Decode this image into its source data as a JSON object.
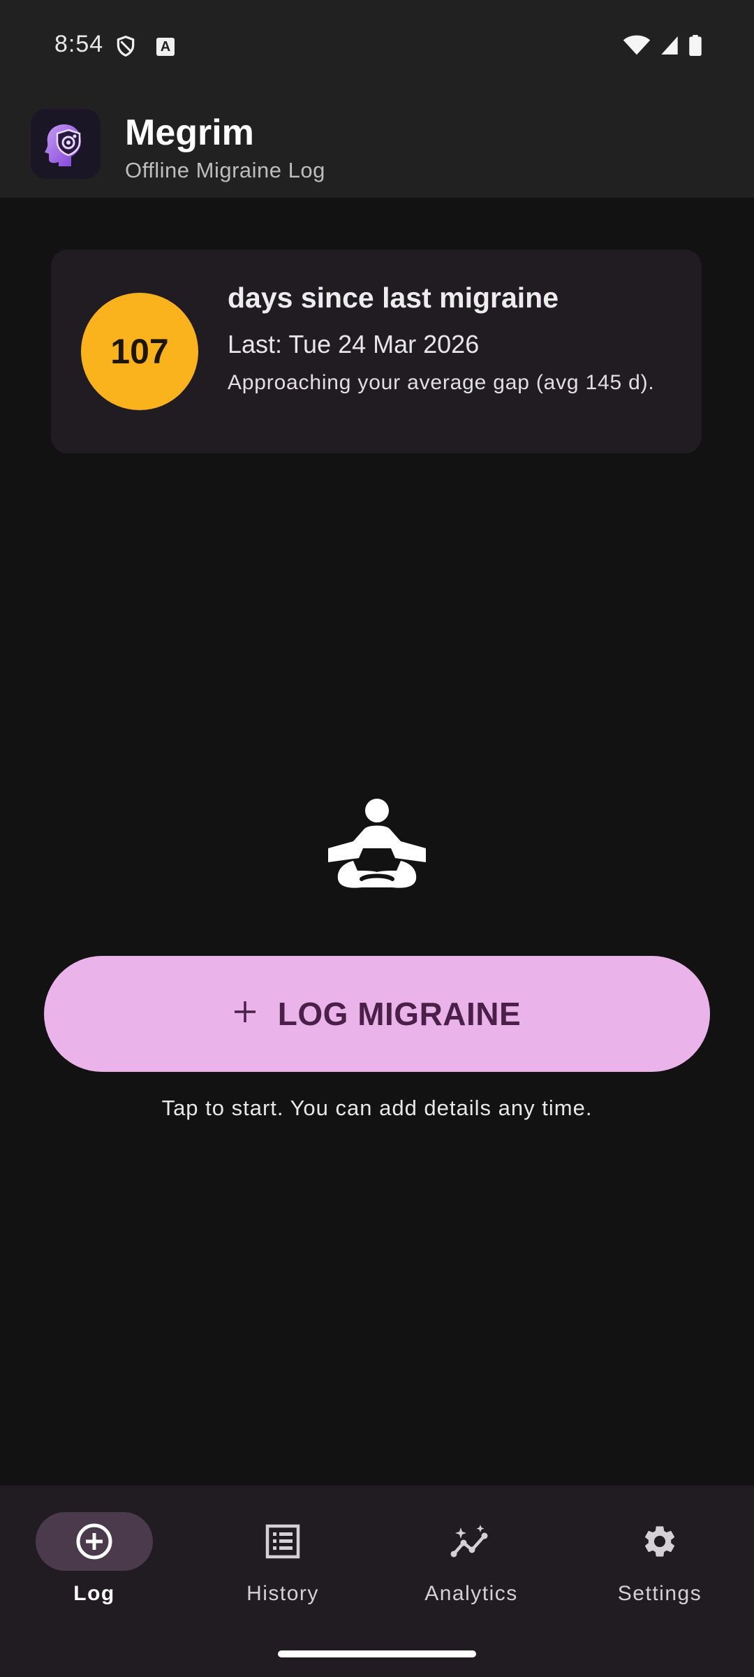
{
  "status_bar": {
    "time": "8:54",
    "icons": [
      "shield-icon",
      "a-badge-icon",
      "wifi-icon",
      "cell-signal-icon",
      "battery-icon"
    ]
  },
  "app_bar": {
    "title": "Megrim",
    "subtitle": "Offline Migraine Log",
    "logo_icon": "head-shield-icon"
  },
  "streak_card": {
    "days": "107",
    "heading": "days since last migraine",
    "last": "Last: Tue 24 Mar 2026",
    "note": "Approaching your average gap (avg 145 d).",
    "circle_color": "#fab31d"
  },
  "main": {
    "illustration": "meditation-icon",
    "log_button": {
      "icon": "plus-icon",
      "label": "LOG MIGRAINE",
      "color": "#eab4ea"
    },
    "hint": "Tap to start. You can add details any time."
  },
  "bottom_nav": {
    "items": [
      {
        "label": "Log",
        "icon": "add-circle-icon",
        "active": true
      },
      {
        "label": "History",
        "icon": "list-icon",
        "active": false
      },
      {
        "label": "Analytics",
        "icon": "insights-icon",
        "active": false
      },
      {
        "label": "Settings",
        "icon": "gear-icon",
        "active": false
      }
    ]
  }
}
